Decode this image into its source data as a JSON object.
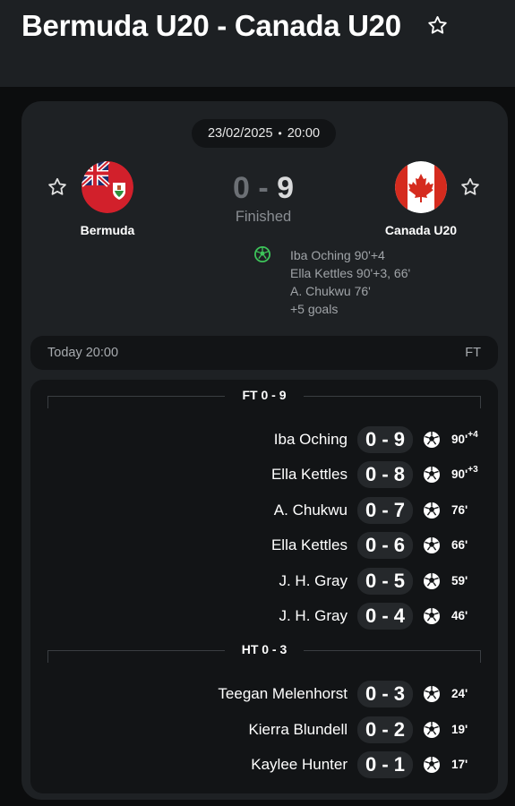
{
  "header": {
    "title": "Bermuda U20 - Canada U20"
  },
  "match": {
    "date": "23/02/2025",
    "time": "20:00",
    "home": {
      "name": "Bermuda",
      "score": "0"
    },
    "away": {
      "name": "Canada U20",
      "score": "9"
    },
    "score_separator": "-",
    "status": "Finished",
    "scorers_summary": [
      "Iba Oching 90'+4",
      "Ella Kettles 90'+3, 66'",
      "A. Chukwu 76'",
      "+5 goals"
    ]
  },
  "today_bar": {
    "left": "Today 20:00",
    "right": "FT"
  },
  "sections": [
    {
      "label": "FT 0 - 9",
      "events": [
        {
          "player": "Iba Oching",
          "score": "0 - 9",
          "minute": "90'",
          "added": "+4"
        },
        {
          "player": "Ella Kettles",
          "score": "0 - 8",
          "minute": "90'",
          "added": "+3"
        },
        {
          "player": "A. Chukwu",
          "score": "0 - 7",
          "minute": "76'",
          "added": ""
        },
        {
          "player": "Ella Kettles",
          "score": "0 - 6",
          "minute": "66'",
          "added": ""
        },
        {
          "player": "J. H. Gray",
          "score": "0 - 5",
          "minute": "59'",
          "added": ""
        },
        {
          "player": "J. H. Gray",
          "score": "0 - 4",
          "minute": "46'",
          "added": ""
        }
      ]
    },
    {
      "label": "HT 0 - 3",
      "events": [
        {
          "player": "Teegan Melenhorst",
          "score": "0 - 3",
          "minute": "24'",
          "added": ""
        },
        {
          "player": "Kierra Blundell",
          "score": "0 - 2",
          "minute": "19'",
          "added": ""
        },
        {
          "player": "Kaylee Hunter",
          "score": "0 - 1",
          "minute": "17'",
          "added": ""
        }
      ]
    }
  ],
  "icons": {
    "favorite": "star-outline-icon",
    "goal": "soccer-ball-icon",
    "home_flag": "bermuda-flag-icon",
    "away_flag": "canada-flag-icon"
  },
  "colors": {
    "background": "#0c0d0e",
    "card": "#1e2124",
    "goal_icon_green": "#3dc45a",
    "muted_score": "#6c7075"
  }
}
